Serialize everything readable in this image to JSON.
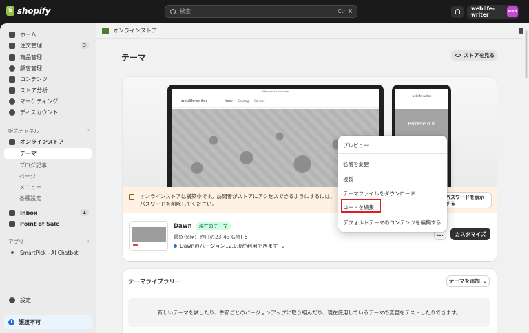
{
  "topbar": {
    "logo_text": "shopify",
    "search_placeholder": "検索",
    "search_shortcut": "Ctrl K",
    "store_name": "weblife-writer",
    "avatar_text": "web"
  },
  "sidebar": {
    "items": [
      {
        "label": "ホーム",
        "badge": ""
      },
      {
        "label": "注文管理",
        "badge": "3"
      },
      {
        "label": "商品管理",
        "badge": ""
      },
      {
        "label": "顧客管理",
        "badge": ""
      },
      {
        "label": "コンテンツ",
        "badge": ""
      },
      {
        "label": "ストア分析",
        "badge": ""
      },
      {
        "label": "マーケティング",
        "badge": ""
      },
      {
        "label": "ディスカウント",
        "badge": ""
      }
    ],
    "sales_channels_label": "販売チャネル",
    "online_store_label": "オンラインストア",
    "online_store_sub": [
      "テーマ",
      "ブログ記事",
      "ページ",
      "メニュー",
      "各種設定"
    ],
    "inbox_label": "Inbox",
    "inbox_badge": "1",
    "pos_label": "Point of Sale",
    "apps_label": "アプリ",
    "app_item": "SmartPick - AI Chatbot",
    "settings_label": "設定",
    "notice_label": "譲渡不可"
  },
  "main": {
    "breadcrumb": "オンラインストア",
    "page_title": "テーマ",
    "view_store_label": "ストアを見る",
    "preview": {
      "announcement": "Welcome to our store",
      "site_name": "weblife-writer",
      "nav_links": [
        "Home",
        "Catalog",
        "Contact"
      ],
      "phone_hero_text": "Browse our"
    },
    "warning_text": "オンラインストアは構築中です。訪問者がストアにアクセスできるようにするには、パスワードを削除してください。",
    "password_button": "パスワードを表示する",
    "theme": {
      "name": "Dawn",
      "badge": "現在のテーマ",
      "saved": "最終保存：昨日の23:43 GMT-5",
      "version": "Dawnのバージョン12.0.0が利用できます",
      "more_label": "…",
      "customize_label": "カスタマイズ"
    },
    "library": {
      "title": "テーマライブラリー",
      "add_label": "テーマを追加",
      "empty_text": "新しいテーマを試したり、季節ごとのバージョンアップに取り組んだり、現在使用しているテーマの変更をテストしたりできます。"
    }
  },
  "popover": {
    "items": [
      "プレビュー",
      "名前を変更",
      "複製",
      "テーマファイルをダウンロード",
      "コードを編集",
      "デフォルトテーマのコンテンツを編集する"
    ]
  },
  "colors": {
    "topbar": "#1a1a1a",
    "badge_green": "#cdfee1",
    "highlight_red": "#e02020",
    "warning_bg": "#fff1e3"
  }
}
